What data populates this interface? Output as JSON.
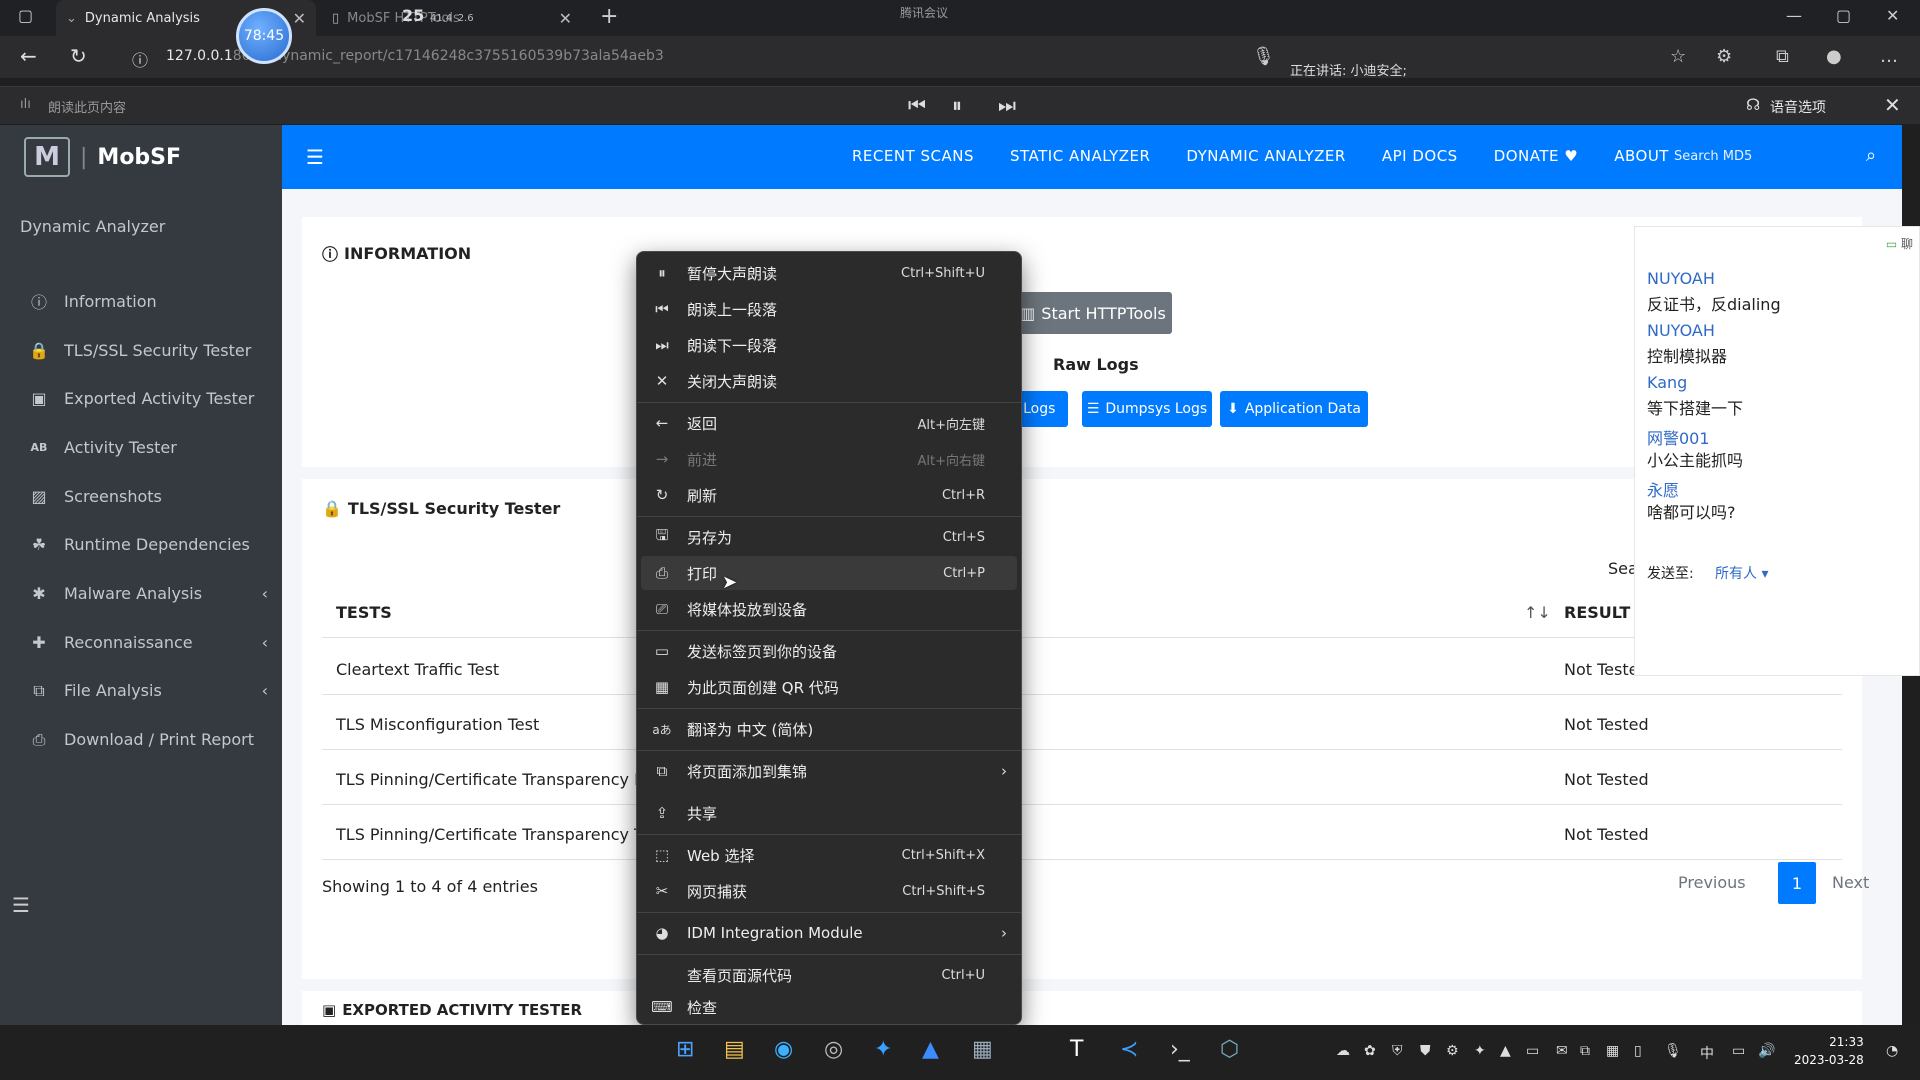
{
  "browser": {
    "active_tab_title": "Dynamic Analysis",
    "inactive_tab_title": "MobSF HTTPTools",
    "timer_badge": "78:45",
    "stat_badge": "25",
    "stat_detail_1": "41.4",
    "stat_detail_2": "2.6",
    "meeting_app": "腾讯会议",
    "url_host": "127.0.0.1",
    "url_path": "8000/dynamic_report/c17146248c3755160539b73ala54aeb3",
    "speaking_label": "正在讲话: 小迪安全;",
    "read_aloud_label": "朗读此页内容",
    "voice_options_label": "语音选项"
  },
  "sidebar": {
    "brand": "MobSF",
    "section": "Dynamic Analyzer",
    "items": [
      {
        "label": "Information",
        "icon": "info-icon",
        "chevron": false
      },
      {
        "label": "TLS/SSL Security Tester",
        "icon": "lock-icon",
        "chevron": false
      },
      {
        "label": "Exported Activity Tester",
        "icon": "cubes-icon",
        "chevron": false
      },
      {
        "label": "Activity Tester",
        "icon": "ab-icon",
        "chevron": false
      },
      {
        "label": "Screenshots",
        "icon": "image-icon",
        "chevron": false
      },
      {
        "label": "Runtime Dependencies",
        "icon": "running-icon",
        "chevron": false
      },
      {
        "label": "Malware Analysis",
        "icon": "bug-icon",
        "chevron": true
      },
      {
        "label": "Reconnaissance",
        "icon": "crosshair-icon",
        "chevron": true
      },
      {
        "label": "File Analysis",
        "icon": "copy-icon",
        "chevron": true
      },
      {
        "label": "Download / Print Report",
        "icon": "print-icon",
        "chevron": false
      }
    ]
  },
  "topnav": {
    "links": [
      "RECENT SCANS",
      "STATIC ANALYZER",
      "DYNAMIC ANALYZER",
      "API DOCS",
      "DONATE ♥",
      "ABOUT"
    ],
    "search_placeholder": "Search MD5"
  },
  "information_card": {
    "title": "INFORMATION",
    "start_httptools": "Start HTTPTools",
    "raw_logs_label": "Raw Logs",
    "buttons": [
      "at Logs",
      "Dumpsys Logs",
      "Application Data"
    ]
  },
  "tls_card": {
    "title": "TLS/SSL Security Tester",
    "search_label": "Sear",
    "columns": [
      "TESTS",
      "RESULT"
    ],
    "rows": [
      {
        "test": "Cleartext Traffic Test",
        "result": "Not Tested"
      },
      {
        "test": "TLS Misconfiguration Test",
        "result": "Not Tested"
      },
      {
        "test": "TLS Pinning/Certificate Transparency By",
        "result": "Not Tested"
      },
      {
        "test": "TLS Pinning/Certificate Transparency Te",
        "result": "Not Tested"
      }
    ],
    "entries_info": "Showing 1 to 4 of 4 entries",
    "pagination": {
      "previous": "Previous",
      "current": "1",
      "next": "Next"
    }
  },
  "exported_card": {
    "title": "EXPORTED ACTIVITY TESTER"
  },
  "chat": {
    "header": "聊",
    "messages": [
      {
        "name": "NUYOAH",
        "text": "反证书，反dialing"
      },
      {
        "name": "NUYOAH",
        "text": "控制模拟器"
      },
      {
        "name": "Kang",
        "text": "等下搭建一下"
      },
      {
        "name": "网警001",
        "text": "小公主能抓吗"
      },
      {
        "name": "永愿",
        "text": "啥都可以吗?"
      }
    ],
    "send_to_label": "发送至:",
    "send_to_target": "所有人 ▾"
  },
  "context_menu": {
    "items": [
      {
        "label": "暂停大声朗读",
        "shortcut": "Ctrl+Shift+U",
        "icon": "pause-icon"
      },
      {
        "label": "朗读上一段落",
        "shortcut": "",
        "icon": "prev-icon"
      },
      {
        "label": "朗读下一段落",
        "shortcut": "",
        "icon": "next-icon"
      },
      {
        "label": "关闭大声朗读",
        "shortcut": "",
        "icon": "close-icon"
      },
      {
        "label": "返回",
        "shortcut": "Alt+向左键",
        "icon": "back-icon"
      },
      {
        "label": "前进",
        "shortcut": "Alt+向右键",
        "icon": "forward-icon",
        "disabled": true
      },
      {
        "label": "刷新",
        "shortcut": "Ctrl+R",
        "icon": "refresh-icon"
      },
      {
        "label": "另存为",
        "shortcut": "Ctrl+S",
        "icon": "save-icon"
      },
      {
        "label": "打印",
        "shortcut": "Ctrl+P",
        "icon": "print-icon"
      },
      {
        "label": "将媒体投放到设备",
        "shortcut": "",
        "icon": "cast-icon"
      },
      {
        "label": "发送标签页到你的设备",
        "shortcut": "",
        "icon": "device-icon"
      },
      {
        "label": "为此页面创建 QR 代码",
        "shortcut": "",
        "icon": "qr-icon"
      },
      {
        "label": "翻译为 中文 (简体)",
        "shortcut": "",
        "icon": "translate-icon"
      },
      {
        "label": "将页面添加到集锦",
        "shortcut": "",
        "icon": "collection-icon",
        "submenu": true
      },
      {
        "label": "共享",
        "shortcut": "",
        "icon": "share-icon"
      },
      {
        "label": "Web 选择",
        "shortcut": "Ctrl+Shift+X",
        "icon": "select-icon"
      },
      {
        "label": "网页捕获",
        "shortcut": "Ctrl+Shift+S",
        "icon": "capture-icon"
      },
      {
        "label": "IDM Integration Module",
        "shortcut": "",
        "icon": "idm-icon",
        "submenu": true
      },
      {
        "label": "查看页面源代码",
        "shortcut": "Ctrl+U",
        "icon": ""
      },
      {
        "label": "检查",
        "shortcut": "",
        "icon": "inspect-icon"
      }
    ]
  },
  "taskbar": {
    "clock_time": "21:33",
    "clock_date": "2023-03-28",
    "ime": "中"
  }
}
